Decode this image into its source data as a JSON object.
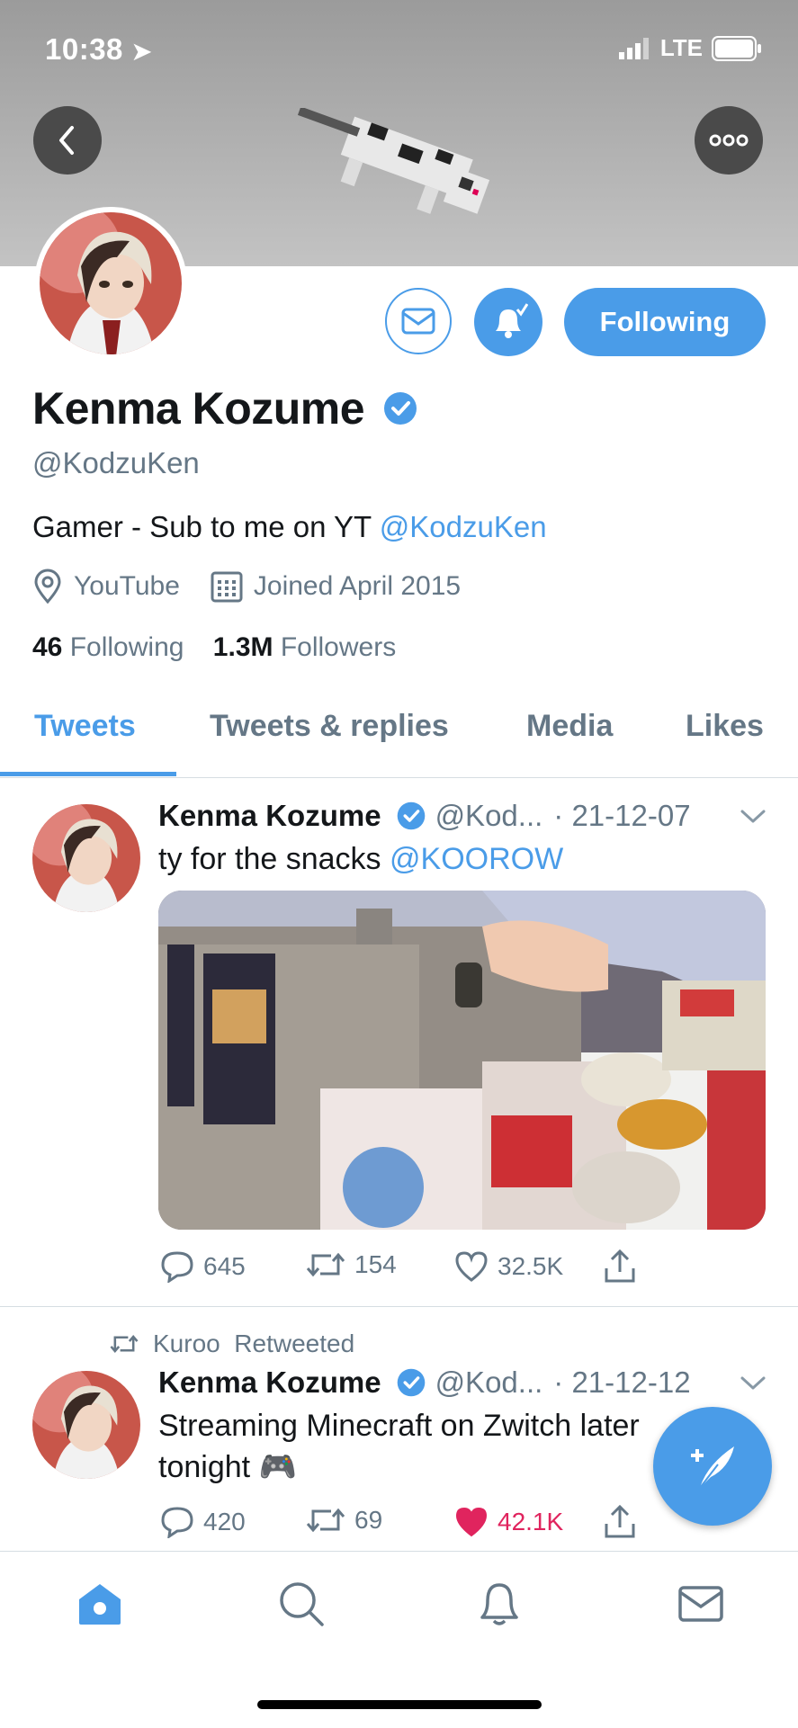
{
  "status_bar": {
    "time": "10:38",
    "network": "LTE"
  },
  "profile": {
    "name": "Kenma Kozume",
    "handle": "@KodzuKen",
    "bio_text": "Gamer - Sub to me on YT ",
    "bio_link": "@KodzuKen",
    "location": "YouTube",
    "joined": "Joined April 2015",
    "following_count": "46",
    "following_label": "Following",
    "followers_count": "1.3M",
    "followers_label": "Followers",
    "follow_button": "Following"
  },
  "tabs": [
    "Tweets",
    "Tweets & replies",
    "Media",
    "Likes"
  ],
  "tweets": [
    {
      "name": "Kenma Kozume",
      "handle": "@Kod...",
      "date": "· 21-12-07",
      "text": "ty for the snacks ",
      "mention": "@KOOROW",
      "replies": "645",
      "retweets": "154",
      "likes": "32.5K"
    },
    {
      "retweeted_by": "Kuroo  Retweeted",
      "name": "Kenma Kozume",
      "handle": "@Kod...",
      "date": "· 21-12-12",
      "text_line1": "Streaming Minecraft on Zwitch later",
      "text_line2": "tonight 🎮",
      "replies": "420",
      "retweets": "69",
      "likes": "42.1K"
    }
  ],
  "colors": {
    "accent": "#4a9ce8",
    "like": "#e0245e",
    "muted": "#657786"
  }
}
